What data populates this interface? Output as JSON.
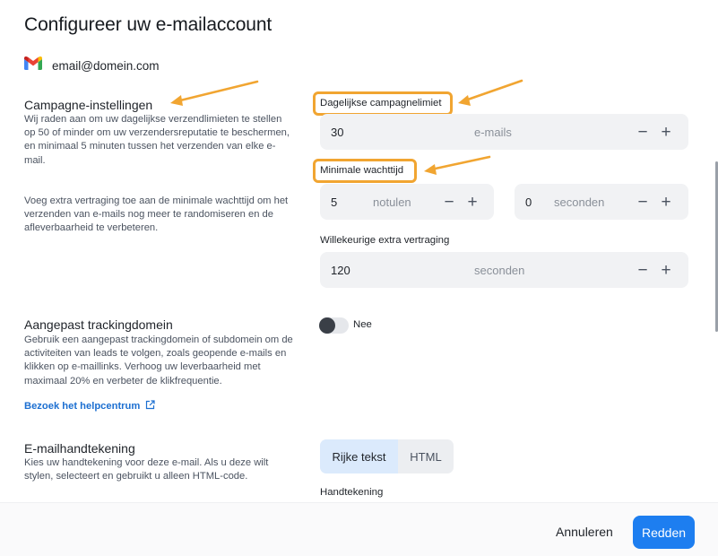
{
  "header": {
    "title": "Configureer uw e-mailaccount",
    "account_icon": "gmail-logo",
    "account_email": "email@domein.com"
  },
  "campaign": {
    "title": "Campagne-instellingen",
    "desc_1": "Wij raden aan om uw dagelijkse verzendlimieten te stellen op 50 of minder om uw verzendersreputatie te beschermen, en minimaal 5 minuten tussen het verzenden van elke e-mail.",
    "desc_2": "Voeg extra vertraging toe aan de minimale wachttijd om het verzenden van e-mails nog meer te randomiseren en de afleverbaarheid te verbeteren.",
    "daily_limit_label": "Dagelijkse campagnelimiet",
    "daily_limit_value": "30",
    "daily_limit_unit": "e-mails",
    "min_wait_label": "Minimale wachttijd",
    "min_wait_minutes_value": "5",
    "min_wait_minutes_unit": "notulen",
    "min_wait_seconds_value": "0",
    "min_wait_seconds_unit": "seconden",
    "random_delay_label": "Willekeurige extra vertraging",
    "random_delay_value": "120",
    "random_delay_unit": "seconden",
    "minus": "−",
    "plus": "+"
  },
  "tracking": {
    "title": "Aangepast trackingdomein",
    "desc": "Gebruik een aangepast trackingdomein of subdomein om de activiteiten van leads te volgen, zoals geopende e-mails en klikken op e-maillinks. Verhoog uw leverbaarheid met maximaal 20% en verbeter de klikfrequentie.",
    "help_link": "Bezoek het helpcentrum",
    "toggle_label": "Nee",
    "toggle_on": false
  },
  "signature": {
    "title": "E-mailhandtekening",
    "desc": "Kies uw handtekening voor deze e-mail. Als u deze wilt stylen, selecteert en gebruikt u alleen HTML-code.",
    "tab_rich": "Rijke tekst",
    "tab_html": "HTML",
    "active_tab": "Rijke tekst",
    "signature_label": "Handtekening"
  },
  "footer": {
    "cancel": "Annuleren",
    "save": "Redden"
  },
  "colors": {
    "accent": "#1d7ef0",
    "highlight": "#f1a531",
    "link": "#1c6fd1"
  }
}
